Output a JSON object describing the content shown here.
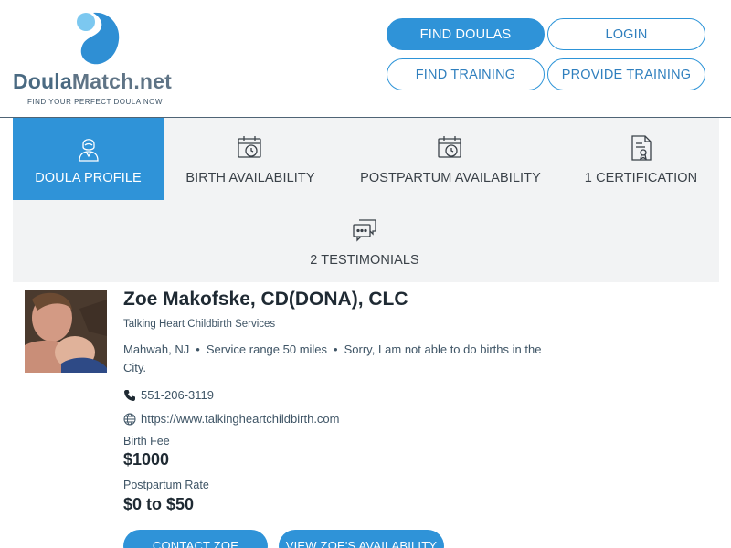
{
  "brand": {
    "word_part1": "Doula",
    "word_part2": "Match.net",
    "tagline": "FIND YOUR PERFECT DOULA NOW"
  },
  "nav": {
    "find_doulas": "FIND DOULAS",
    "login": "LOGIN",
    "find_training": "FIND TRAINING",
    "provide_training": "PROVIDE TRAINING"
  },
  "tabs": [
    {
      "label": "DOULA PROFILE",
      "icon": "doula-person-icon",
      "active": true
    },
    {
      "label": "BIRTH AVAILABILITY",
      "icon": "calendar-clock-icon",
      "active": false
    },
    {
      "label": "POSTPARTUM AVAILABILITY",
      "icon": "calendar-clock-icon",
      "active": false
    },
    {
      "label": "1 CERTIFICATION",
      "icon": "certificate-icon",
      "active": false
    },
    {
      "label": "2 TESTIMONIALS",
      "icon": "chat-bubbles-icon",
      "active": false
    }
  ],
  "profile": {
    "name": "Zoe Makofske, CD(DONA), CLC",
    "organization": "Talking Heart Childbirth Services",
    "location": "Mahwah, NJ",
    "service_range": "Service range 50 miles",
    "note": "Sorry, I am not able to do births in the City.",
    "phone": "551-206-3119",
    "website": "https://www.talkingheartchildbirth.com",
    "birth_fee_label": "Birth Fee",
    "birth_fee": "$1000",
    "postpartum_rate_label": "Postpartum Rate",
    "postpartum_rate": "$0 to $50"
  },
  "actions": {
    "contact": "CONTACT ZOE",
    "availability": "VIEW ZOE'S AVAILABILITY"
  },
  "colors": {
    "accent": "#2f93d8",
    "tab_bg": "#f2f3f4",
    "text_dark": "#1f2a33",
    "text_muted": "#3f5566"
  }
}
